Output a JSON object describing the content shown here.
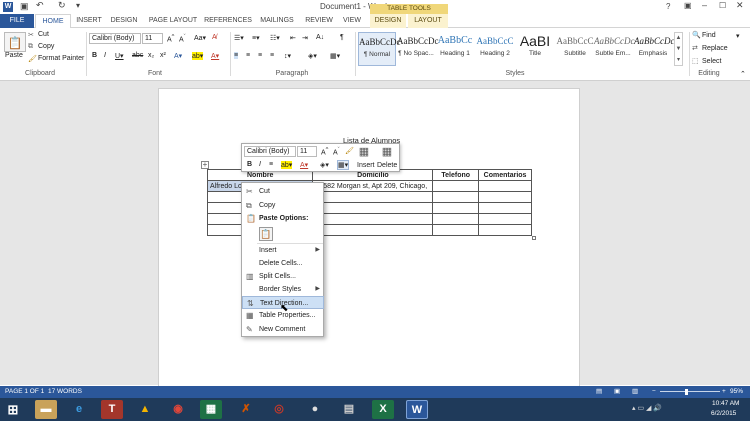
{
  "titlebar": {
    "title": "Document1 - Word",
    "help": "?"
  },
  "tabs": {
    "file": "FILE",
    "home": "HOME",
    "insert": "INSERT",
    "design": "DESIGN",
    "page_layout": "PAGE LAYOUT",
    "references": "REFERENCES",
    "mailings": "MAILINGS",
    "review": "REVIEW",
    "view": "VIEW",
    "table_tools": "TABLE TOOLS",
    "tt_design": "DESIGN",
    "tt_layout": "LAYOUT"
  },
  "ribbon": {
    "paste": "Paste",
    "cut": "Cut",
    "copy": "Copy",
    "format_painter": "Format Painter",
    "clipboard": "Clipboard",
    "font_name": "Calibri (Body)",
    "font_size": "11",
    "font": "Font",
    "paragraph": "Paragraph",
    "styles": "Styles",
    "editing": "Editing",
    "find": "Find",
    "replace": "Replace",
    "select": "Select",
    "style_items": [
      {
        "preview": "AaBbCcDc",
        "name": "¶ Normal"
      },
      {
        "preview": "AaBbCcDc",
        "name": "¶ No Spac..."
      },
      {
        "preview": "AaBbCc",
        "name": "Heading 1"
      },
      {
        "preview": "AaBbCcC",
        "name": "Heading 2"
      },
      {
        "preview": "AaBI",
        "name": "Title"
      },
      {
        "preview": "AaBbCcC",
        "name": "Subtitle"
      },
      {
        "preview": "AaBbCcDc",
        "name": "Subtle Em..."
      },
      {
        "preview": "AaBbCcDc",
        "name": "Emphasis"
      }
    ]
  },
  "document": {
    "table_title": "Lista de Alumnos",
    "headers": [
      "Nombre",
      "Domicilio",
      "Telefono",
      "Comentarios"
    ],
    "row1": [
      "Alfredo Lozano Martinez",
      "13582 Morgan st, Apt 209, Chicago,",
      "",
      ""
    ]
  },
  "minitoolbar": {
    "font": "Calibri (Body)",
    "size": "11",
    "insert": "Insert",
    "delete": "Delete"
  },
  "context_menu": {
    "cut": "Cut",
    "copy": "Copy",
    "paste_options": "Paste Options:",
    "insert": "Insert",
    "delete_cells": "Delete Cells...",
    "split_cells": "Split Cells...",
    "border_styles": "Border Styles",
    "text_direction": "Text Direction...",
    "table_properties": "Table Properties...",
    "new_comment": "New Comment"
  },
  "statusbar": {
    "page": "PAGE 1 OF 1",
    "words": "17 WORDS",
    "zoom": "95%"
  },
  "taskbar": {
    "time": "10:47 AM",
    "date": "6/2/2015"
  },
  "colors": {
    "accent": "#2b579a",
    "table_tools": "#f0d77a"
  }
}
